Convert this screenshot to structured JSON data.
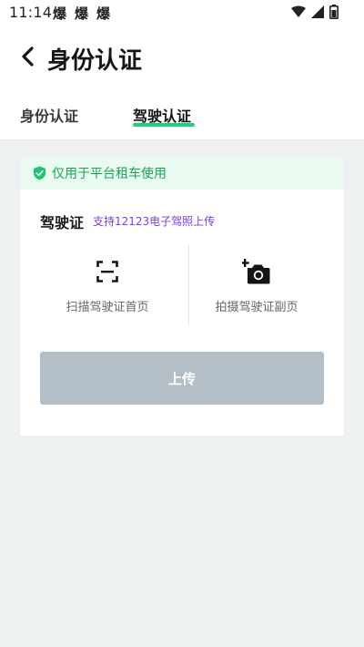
{
  "status_bar": {
    "time": "11:14",
    "notification_icons": [
      "爆",
      "爆",
      "爆"
    ],
    "right_icons": [
      "wifi-icon",
      "signal-icon",
      "battery-icon"
    ]
  },
  "header": {
    "title": "身份认证",
    "back_icon": "chevron-left-icon"
  },
  "tabs": [
    {
      "label": "身份认证",
      "active": false
    },
    {
      "label": "驾驶认证",
      "active": true
    }
  ],
  "notice": {
    "icon": "shield-check-icon",
    "text": "仅用于平台租车使用"
  },
  "license": {
    "title": "驾驶证",
    "hint": "支持12123电子驾照上传"
  },
  "upload_options": [
    {
      "label": "扫描驾驶证首页",
      "icon": "scan-icon"
    },
    {
      "label": "拍摄驾驶证副页",
      "icon": "add-camera-icon"
    }
  ],
  "submit": {
    "label": "上传"
  },
  "colors": {
    "accent_green": "#21d07a",
    "notice_bg": "#e9faf0",
    "notice_text": "#1ba35a",
    "hint_purple": "#7a3ee6",
    "disabled_button": "#b4bec6",
    "page_bg": "#eef1f1"
  }
}
